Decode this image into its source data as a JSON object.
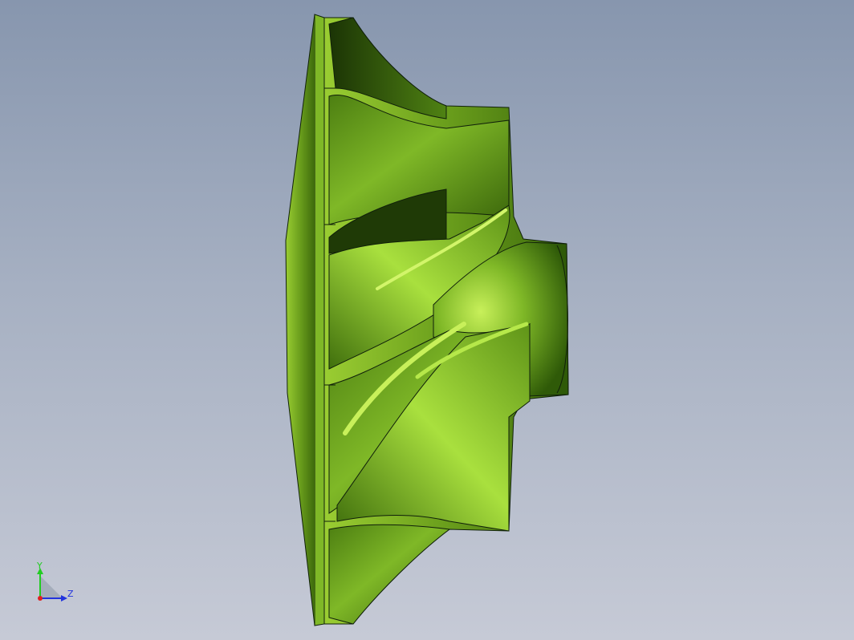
{
  "viewport": {
    "background_top": "#8796ae",
    "background_bottom": "#c6cad6"
  },
  "model": {
    "part": "impeller",
    "color": "#6a9e1c",
    "highlight": "#b6e84a",
    "shadow": "#1e3a05",
    "edge_color": "#10200a"
  },
  "triad": {
    "y_label": "Y",
    "z_label": "Z",
    "x_color": "#e02020",
    "y_color": "#22cc22",
    "z_color": "#2233dd"
  }
}
